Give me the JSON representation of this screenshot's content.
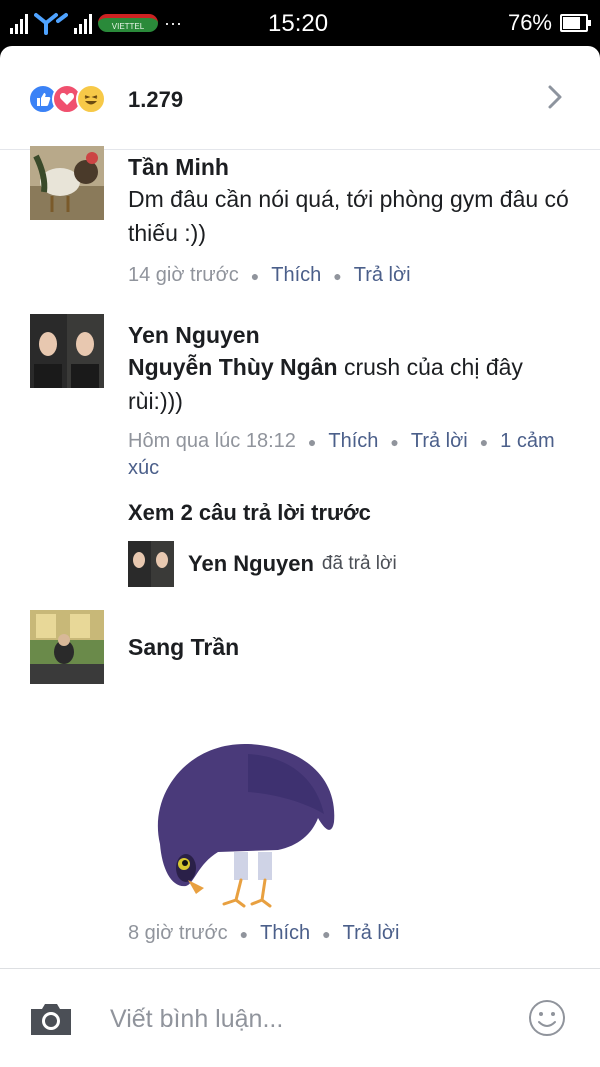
{
  "status_bar": {
    "time": "15:20",
    "battery": "76%",
    "battery_level": 0.76,
    "network_type": "H+",
    "operator": "VIETTEL",
    "more": "···"
  },
  "reactions": {
    "count": "1.279",
    "icons": [
      "like-icon",
      "love-icon",
      "haha-icon"
    ],
    "colors": {
      "like": "#3b82f6",
      "love": "#f0506e",
      "haha": "#f7c948"
    }
  },
  "comments": [
    {
      "name": "Tần Minh",
      "text": "Dm đâu cần nói quá, tới phòng gym đâu có thiếu :))",
      "time": "14 giờ trước",
      "like": "Thích",
      "reply": "Trả lời"
    },
    {
      "name": "Yen Nguyen",
      "tag": "Nguyễn Thùy Ngân",
      "text": " crush của chị đây rùi:)))",
      "time": "Hôm qua lúc 18:12",
      "like": "Thích",
      "reply": "Trả lời",
      "reactions": "1 cảm xúc"
    },
    {
      "name": "Sang Trần",
      "time": "8 giờ trước",
      "like": "Thích",
      "reply": "Trả lời"
    }
  ],
  "replies": {
    "see_previous": "Xem 2 câu trả lời trước",
    "reply_name": "Yen Nguyen",
    "reply_verb": "đã trả lời"
  },
  "composer": {
    "placeholder": "Viết bình luận..."
  }
}
